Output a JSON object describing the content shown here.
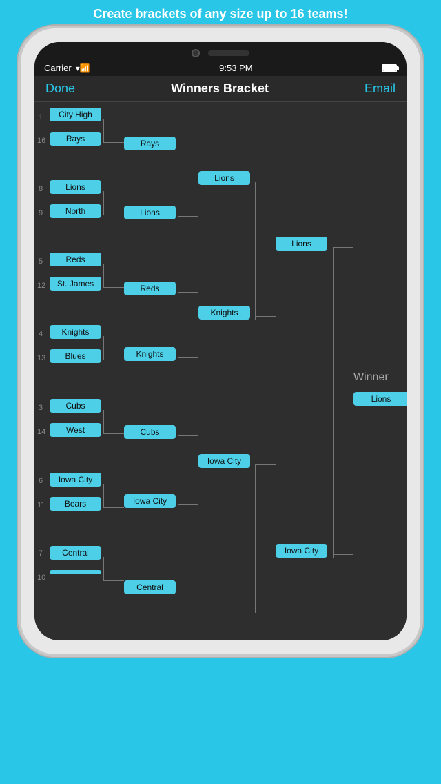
{
  "banner": {
    "text": "Create brackets of any size up to 16 teams!"
  },
  "status_bar": {
    "carrier": "Carrier",
    "time": "9:53 PM"
  },
  "nav": {
    "done": "Done",
    "title": "Winners Bracket",
    "email": "Email"
  },
  "bracket": {
    "winner_label": "Winner",
    "winner_team": "Lions",
    "seeds": [
      1,
      16,
      8,
      9,
      5,
      12,
      4,
      13,
      3,
      14,
      6,
      11,
      7,
      10
    ],
    "round1": [
      {
        "seed": 1,
        "name": "City High"
      },
      {
        "seed": 16,
        "name": "Rays"
      },
      {
        "seed": 8,
        "name": "Lions"
      },
      {
        "seed": 9,
        "name": "North"
      },
      {
        "seed": 5,
        "name": "Reds"
      },
      {
        "seed": 12,
        "name": "St. James"
      },
      {
        "seed": 4,
        "name": "Knights"
      },
      {
        "seed": 13,
        "name": "Blues"
      },
      {
        "seed": 3,
        "name": "Cubs"
      },
      {
        "seed": 14,
        "name": "West"
      },
      {
        "seed": 6,
        "name": "Iowa City"
      },
      {
        "seed": 11,
        "name": "Bears"
      },
      {
        "seed": 7,
        "name": "Central"
      },
      {
        "seed": 10,
        "name": ""
      }
    ],
    "round2": [
      {
        "name": "Rays"
      },
      {
        "name": "Lions"
      },
      {
        "name": "Reds"
      },
      {
        "name": "Knights"
      },
      {
        "name": "Cubs"
      },
      {
        "name": "Iowa City"
      },
      {
        "name": "Central"
      }
    ],
    "round3": [
      {
        "name": "Lions"
      },
      {
        "name": "Knights"
      },
      {
        "name": "Iowa City"
      }
    ],
    "round4": [
      {
        "name": "Lions"
      },
      {
        "name": "Iowa City"
      }
    ]
  }
}
